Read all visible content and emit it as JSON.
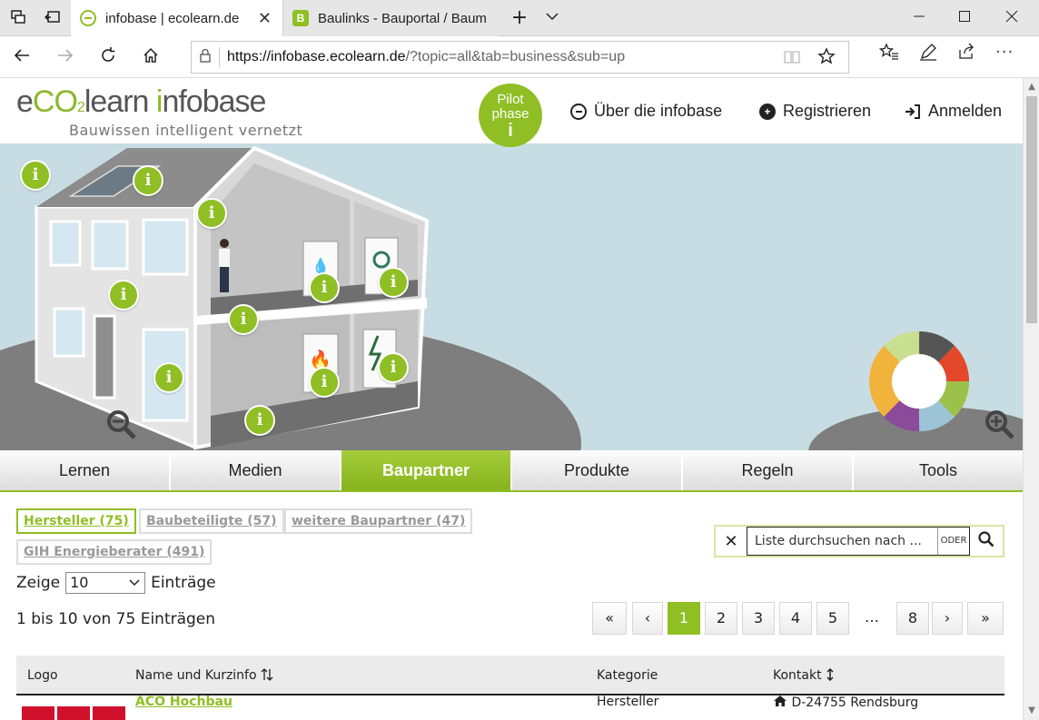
{
  "browser": {
    "tabs": [
      {
        "title": "infobase | ecolearn.de",
        "active": true
      },
      {
        "title": "Baulinks - Bauportal / Baum",
        "active": false
      }
    ],
    "url_host": "https://infobase.ecolearn.de",
    "url_rest": "/?topic=all&tab=business&sub=up"
  },
  "header": {
    "logo_e": "e",
    "logo_co2": "CO",
    "logo_sub2": "2",
    "logo_learn": "learn ",
    "logo_i": "i",
    "logo_nfobase": "nfobase",
    "tagline": "Bauwissen intelligent vernetzt",
    "pilot_line1": "Pilot",
    "pilot_line2": "phase",
    "pilot_icon": "i",
    "nav": [
      {
        "label": "Über die infobase",
        "icon": "info-circle-icon"
      },
      {
        "label": "Registrieren",
        "icon": "plus-circle-icon"
      },
      {
        "label": "Anmelden",
        "icon": "sign-in-icon"
      }
    ]
  },
  "hero": {
    "info_marker": "i"
  },
  "main_nav": [
    {
      "label": "Lernen",
      "active": false
    },
    {
      "label": "Medien",
      "active": false
    },
    {
      "label": "Baupartner",
      "active": true
    },
    {
      "label": "Produkte",
      "active": false
    },
    {
      "label": "Regeln",
      "active": false
    },
    {
      "label": "Tools",
      "active": false
    }
  ],
  "sub_tabs": [
    {
      "label": "Hersteller (75)",
      "active": true
    },
    {
      "label": "Baubeteiligte (57)",
      "active": false
    },
    {
      "label": "weitere Baupartner (47)",
      "active": false
    },
    {
      "label": "GIH Energieberater (491)",
      "active": false
    }
  ],
  "search": {
    "placeholder": "Liste durchsuchen nach ...",
    "oder": "ODER"
  },
  "list": {
    "show_prefix": "Zeige",
    "show_value": "10",
    "show_suffix": "Einträge",
    "count_text": "1 bis 10 von 75 Einträgen"
  },
  "pagination": {
    "first": "«",
    "prev": "‹",
    "pages": [
      "1",
      "2",
      "3",
      "4",
      "5"
    ],
    "ellipsis": "…",
    "last_page": "8",
    "next": "›",
    "last": "»",
    "current": "1"
  },
  "table": {
    "headers": [
      "Logo",
      "Name und Kurzinfo",
      "Kategorie",
      "Kontakt"
    ],
    "rows": [
      {
        "name": "ACO Hochbau",
        "category": "Hersteller",
        "contact": "D-24755 Rendsburg"
      }
    ]
  },
  "colors": {
    "brand_green": "#8fbf24",
    "sky": "#c8dde3"
  }
}
